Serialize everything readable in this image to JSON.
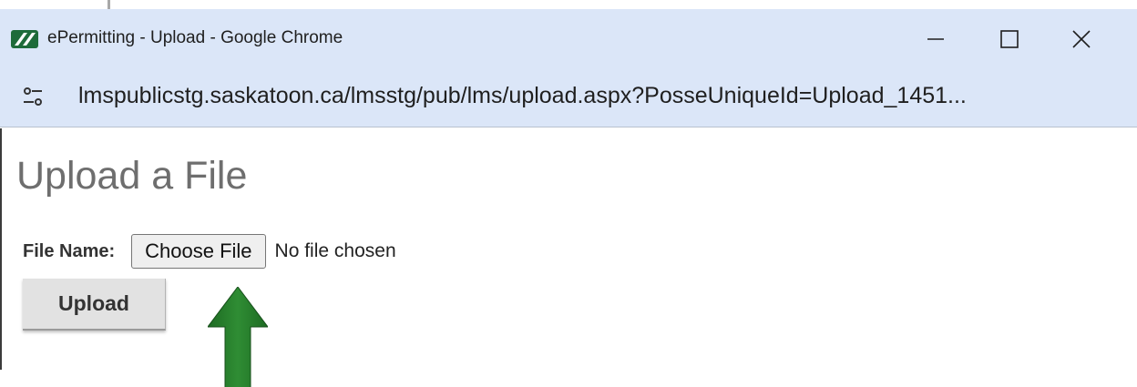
{
  "window": {
    "title": "ePermitting - Upload - Google Chrome",
    "url": "lmspublicstg.saskatoon.ca/lmsstg/pub/lms/upload.aspx?PosseUniqueId=Upload_1451..."
  },
  "form": {
    "heading": "Upload a File",
    "file_label": "File Name:",
    "choose_button_label": "Choose File",
    "file_status": "No file chosen",
    "upload_button_label": "Upload"
  },
  "icons": {
    "app_logo": "epermitting-logo-icon",
    "site_info": "site-info-tune-icon",
    "minimize": "minimize-icon",
    "maximize": "maximize-icon",
    "close": "close-icon",
    "annotation_arrow": "up-arrow-icon"
  },
  "colors": {
    "titlebar_bg": "#dbe6f8",
    "logo_green": "#1e6b3a",
    "arrow_green": "#237a28",
    "heading_gray": "#6e6e6e"
  }
}
